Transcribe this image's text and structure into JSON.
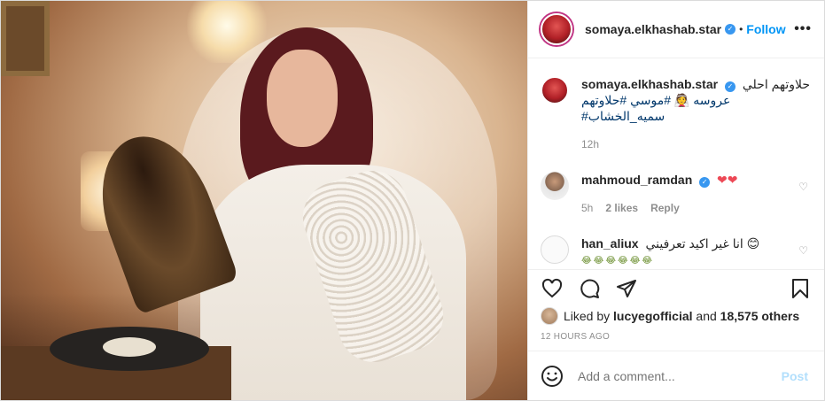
{
  "post": {
    "author": {
      "username": "somaya.elkhashab.star",
      "verified": true,
      "follow_label": "Follow",
      "dot_separator": "•"
    },
    "more_icon": "more-horizontal-icon",
    "caption": {
      "line1": "حلاوتهم احلي",
      "line2": "عروسه 👰 #موسي #حلاوتهم",
      "line3": "#سميه_الخشاب",
      "time": "12h"
    },
    "comments": [
      {
        "username": "mahmoud_ramdan",
        "verified": true,
        "text": "❤❤",
        "time": "5h",
        "likes": "2 likes",
        "reply_label": "Reply"
      },
      {
        "username": "han_aliux",
        "verified": false,
        "text": "انا غير اكيد تعرفيني 😊",
        "emoji_line": "😂😂😂😂😂😂"
      }
    ],
    "actions": {
      "like_icon": "heart-icon",
      "comment_icon": "comment-icon",
      "share_icon": "paper-plane-icon",
      "save_icon": "bookmark-icon"
    },
    "liked_by": {
      "prefix": "Liked by",
      "user": "lucyegofficial",
      "middle": "and",
      "others": "18,575 others"
    },
    "timestamp": "12 HOURS AGO",
    "add_comment": {
      "placeholder": "Add a comment...",
      "post_label": "Post"
    }
  },
  "colors": {
    "link_blue": "#0095f6",
    "verified_blue": "#3897f0",
    "hashtag": "#00376b",
    "muted": "#8e8e8e",
    "post_disabled": "#b2dffc",
    "heart_red": "#ed4956"
  }
}
